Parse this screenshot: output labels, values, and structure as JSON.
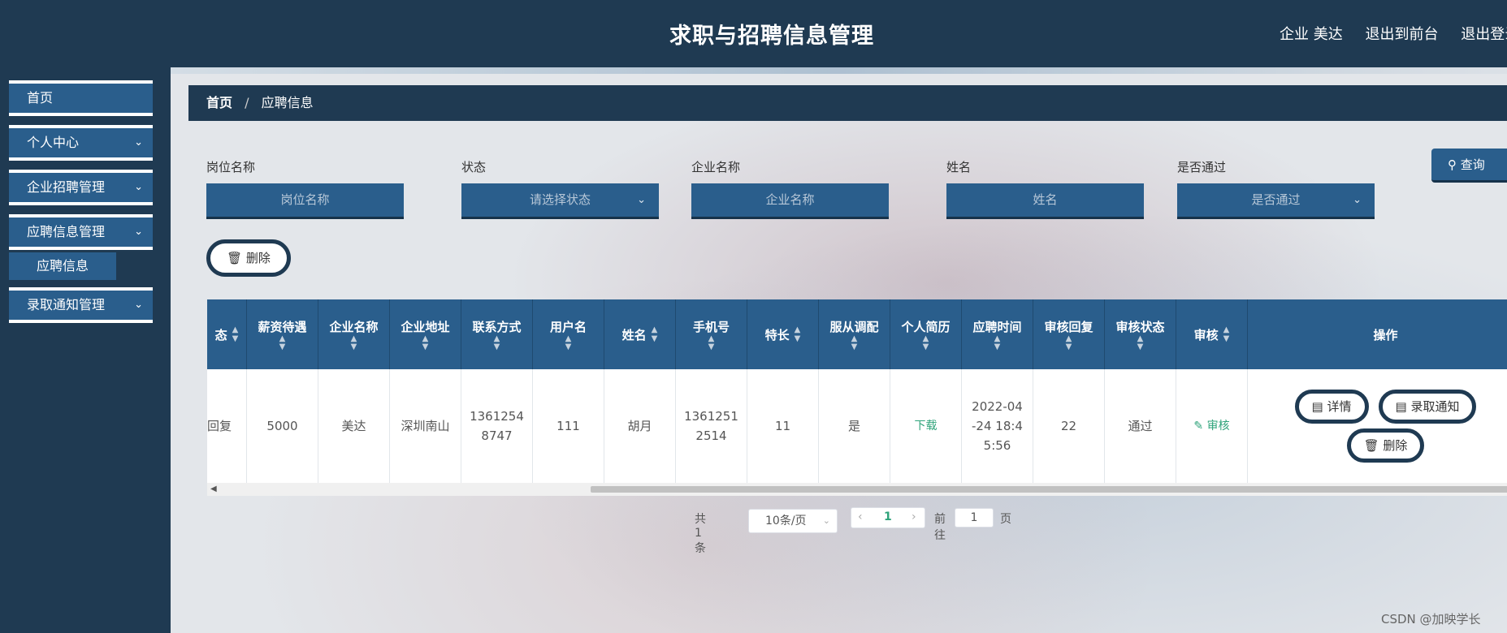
{
  "header": {
    "title": "求职与招聘信息管理",
    "user_label": "企业 美达",
    "to_front": "退出到前台",
    "logout": "退出登录"
  },
  "sidebar": {
    "items": [
      {
        "label": "首页"
      },
      {
        "label": "个人中心"
      },
      {
        "label": "企业招聘管理"
      },
      {
        "label": "应聘信息管理"
      },
      {
        "label": "录取通知管理"
      }
    ],
    "sub_item": "应聘信息"
  },
  "breadcrumb": {
    "home": "首页",
    "sep": "/",
    "current": "应聘信息"
  },
  "filters": {
    "job_label": "岗位名称",
    "job_placeholder": "岗位名称",
    "status_label": "状态",
    "status_placeholder": "请选择状态",
    "company_label": "企业名称",
    "company_placeholder": "企业名称",
    "name_label": "姓名",
    "name_placeholder": "姓名",
    "pass_label": "是否通过",
    "pass_placeholder": "是否通过",
    "query_button": "查询"
  },
  "actions": {
    "delete_button": "删除"
  },
  "table": {
    "headers": [
      "态",
      "薪资待遇",
      "企业名称",
      "企业地址",
      "联系方式",
      "用户名",
      "姓名",
      "手机号",
      "特长",
      "服从调配",
      "个人简历",
      "应聘时间",
      "审核回复",
      "审核状态",
      "审核",
      "操作"
    ],
    "row": {
      "status": "回复",
      "salary": "5000",
      "company": "美达",
      "address": "深圳南山",
      "contact": "1361254 8747",
      "username": "111",
      "name": "胡月",
      "phone": "1361251 2514",
      "skill": "11",
      "obey": "是",
      "resume": "下载",
      "time": "2022-04 -24 18:4 5:56",
      "reply": "22",
      "review_status": "通过",
      "review": "审核",
      "op_detail": "详情",
      "op_notify": "录取通知",
      "op_delete": "删除"
    }
  },
  "pagination": {
    "total": "共 1 条",
    "page_size": "10条/页",
    "current_page": "1",
    "goto_label": "前往",
    "goto_value": "1",
    "page_suffix": "页"
  },
  "watermark": "CSDN @加映学长",
  "colors": {
    "header_bg": "#1f3a52",
    "accent": "#2a5e8c",
    "link_green": "#2ea37a"
  }
}
